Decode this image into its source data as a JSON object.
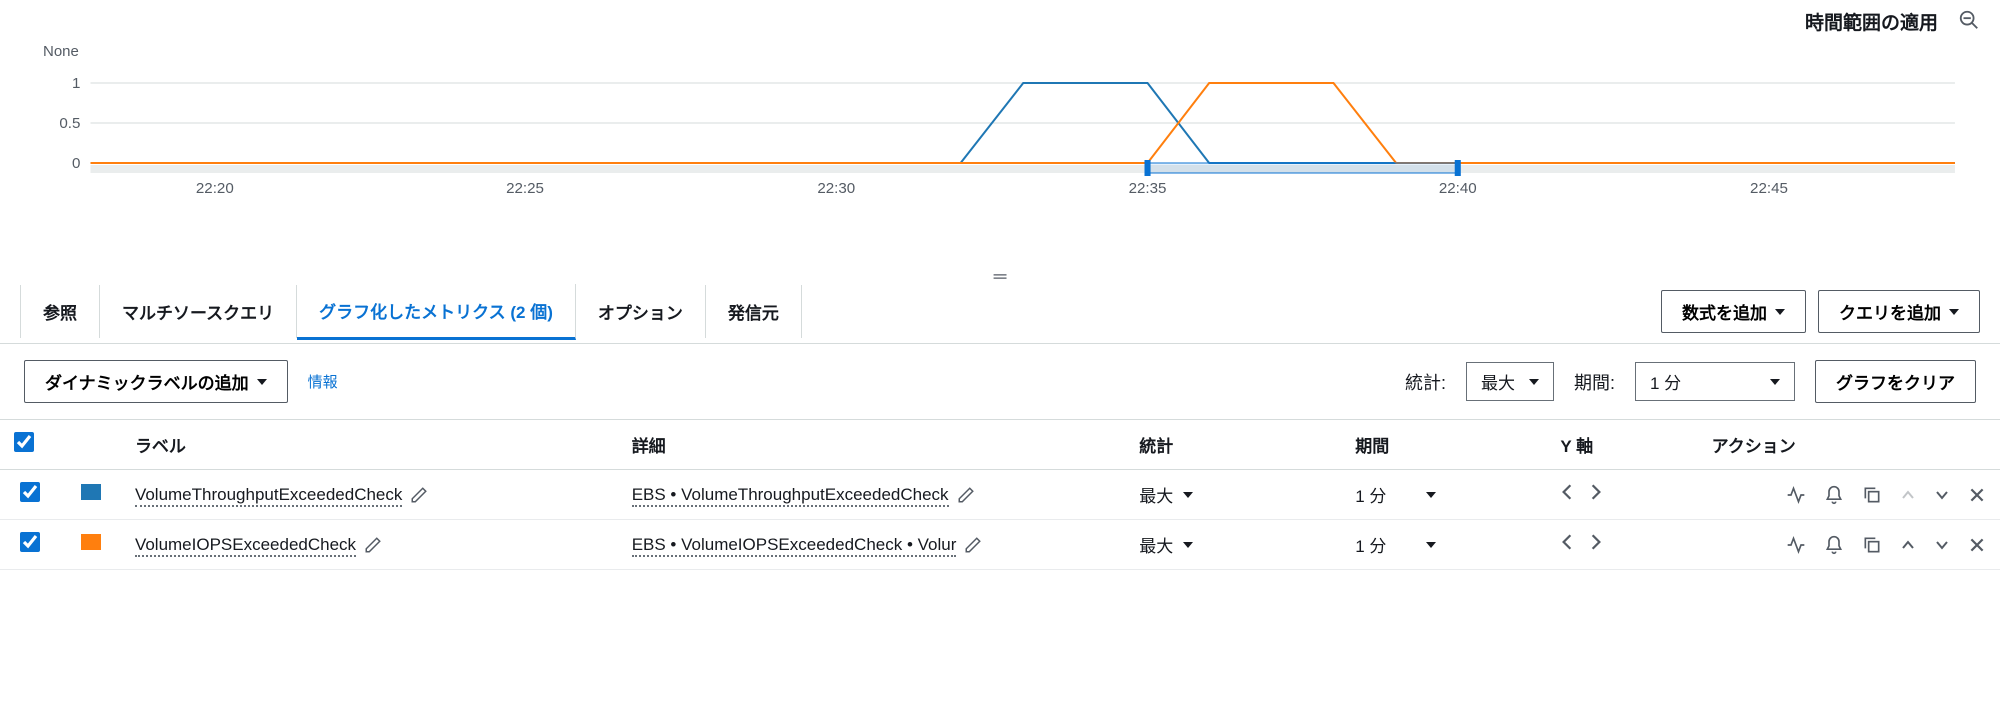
{
  "header": {
    "title": "時間範囲の適用"
  },
  "chart_data": {
    "type": "line",
    "none_label": "None",
    "y_ticks": [
      0,
      0.5,
      1
    ],
    "x_ticks": [
      "22:20",
      "22:25",
      "22:30",
      "22:35",
      "22:40",
      "22:45"
    ],
    "x_range": [
      "22:18",
      "22:48"
    ],
    "series": [
      {
        "name": "VolumeThroughputExceededCheck",
        "color": "#1f77b4",
        "points": [
          {
            "x": "22:18",
            "y": 0
          },
          {
            "x": "22:32",
            "y": 0
          },
          {
            "x": "22:33",
            "y": 1
          },
          {
            "x": "22:35",
            "y": 1
          },
          {
            "x": "22:36",
            "y": 0
          },
          {
            "x": "22:48",
            "y": 0
          }
        ]
      },
      {
        "name": "VolumeIOPSExceededCheck",
        "color": "#ff7f0e",
        "points": [
          {
            "x": "22:18",
            "y": 0
          },
          {
            "x": "22:35",
            "y": 0
          },
          {
            "x": "22:36",
            "y": 1
          },
          {
            "x": "22:38",
            "y": 1
          },
          {
            "x": "22:39",
            "y": 0
          },
          {
            "x": "22:48",
            "y": 0
          }
        ]
      }
    ],
    "brush": {
      "start": "22:35",
      "end": "22:40"
    }
  },
  "tabs": {
    "items": [
      {
        "label": "参照"
      },
      {
        "label": "マルチソースクエリ"
      },
      {
        "label": "グラフ化したメトリクス (2 個)",
        "active": true
      },
      {
        "label": "オプション"
      },
      {
        "label": "発信元"
      }
    ],
    "add_expression": "数式を追加",
    "add_query": "クエリを追加"
  },
  "controls": {
    "dynamic_label_btn": "ダイナミックラベルの追加",
    "info_link": "情報",
    "stat_label": "統計:",
    "stat_value": "最大",
    "period_label": "期間:",
    "period_value": "1 分",
    "clear_graph_btn": "グラフをクリア"
  },
  "table": {
    "headers": {
      "label": "ラベル",
      "detail": "詳細",
      "stat": "統計",
      "period": "期間",
      "yaxis": "Y 軸",
      "actions": "アクション"
    },
    "rows": [
      {
        "checked": true,
        "swatch": "blue",
        "label": "VolumeThroughputExceededCheck",
        "detail": "EBS • VolumeThroughputExceededCheck",
        "stat": "最大",
        "period": "1 分",
        "up_disabled": true
      },
      {
        "checked": true,
        "swatch": "orange",
        "label": "VolumeIOPSExceededCheck",
        "detail": "EBS • VolumeIOPSExceededCheck • Volur",
        "stat": "最大",
        "period": "1 分",
        "up_disabled": false
      }
    ]
  }
}
